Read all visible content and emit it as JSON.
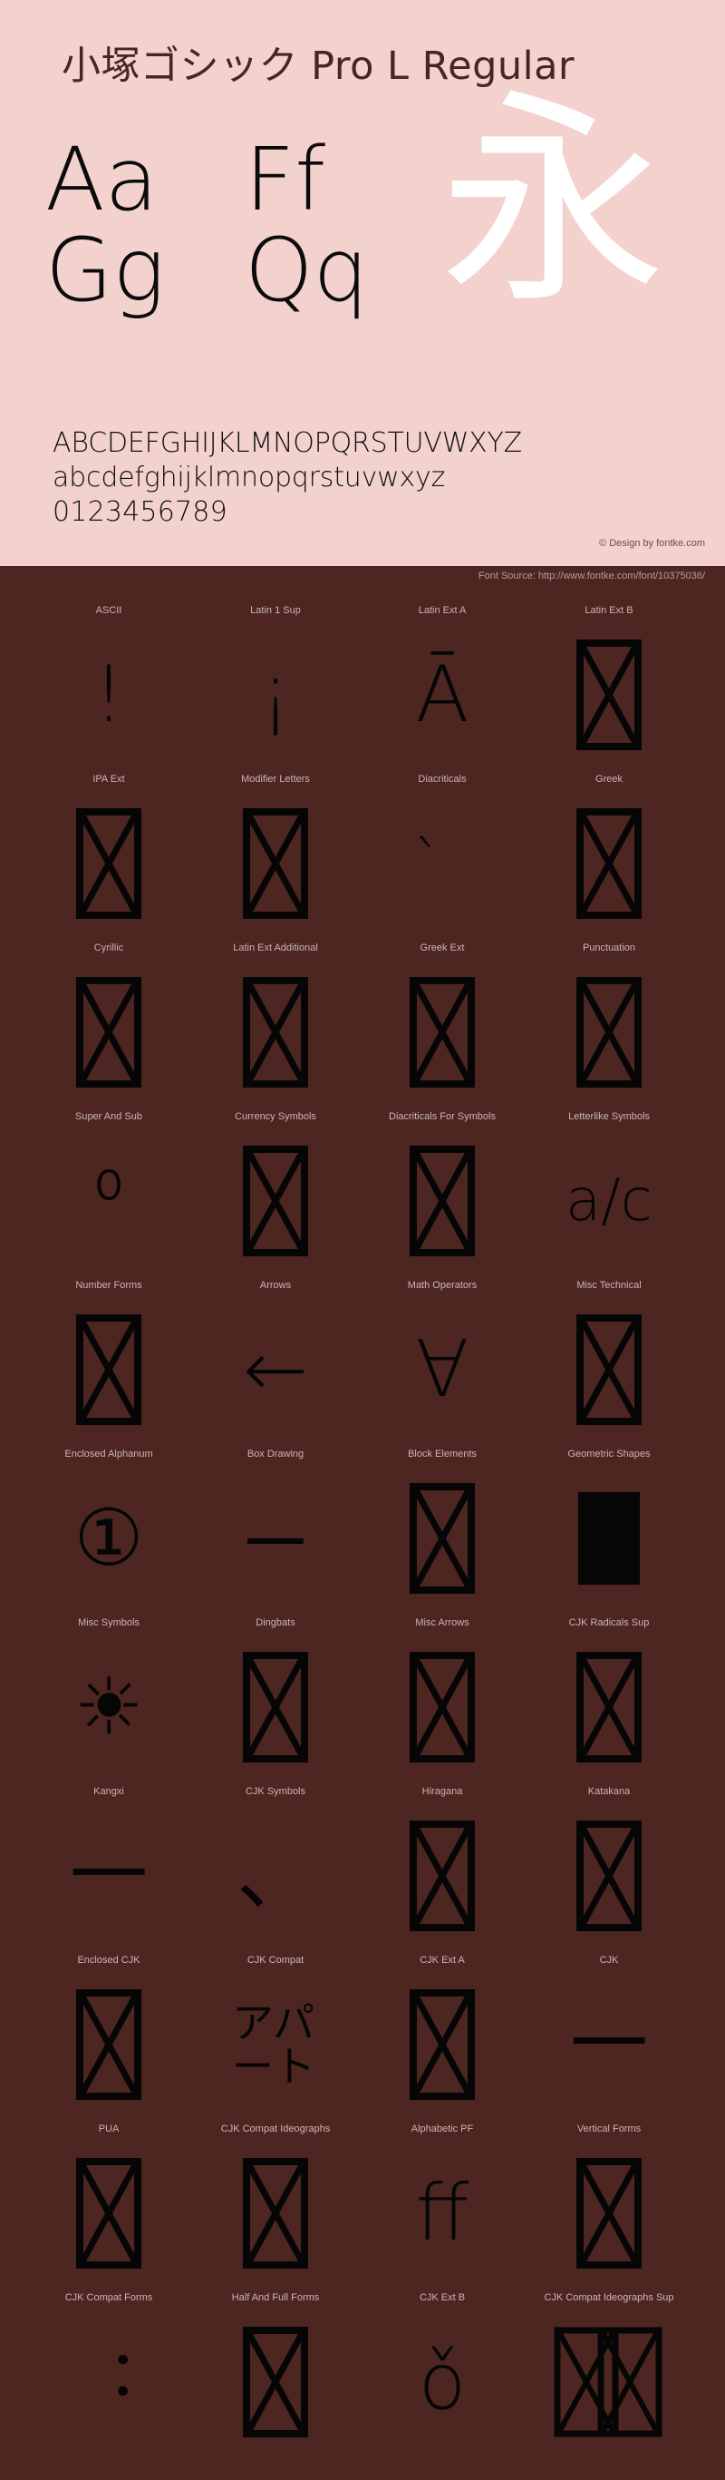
{
  "specimen": {
    "title": "小塚ゴシック Pro L Regular",
    "sample_glyphs": [
      [
        "Aa",
        "Ff"
      ],
      [
        "Gg",
        "Qq"
      ]
    ],
    "watermark_glyph": "永",
    "uppercase": "ABCDEFGHIJKLMNOPQRSTUVWXYZ",
    "lowercase": "abcdefghijklmnopqrstuvwxyz",
    "digits": "0123456789",
    "credit": "© Design by fontke.com",
    "colors": {
      "panel_background": "#f3d1cd",
      "page_background": "#4d2622",
      "glyph": "#0b0b0b",
      "watermark": "#ffffff",
      "label": "#cbb5b2"
    }
  },
  "source_bar": {
    "text": "Font Source: http://www.fontke.com/font/10375036/"
  },
  "blocks": [
    {
      "label": "ASCII",
      "sample": "!",
      "kind": "glyph"
    },
    {
      "label": "Latin 1 Sup",
      "sample": "¡",
      "kind": "glyph"
    },
    {
      "label": "Latin Ext A",
      "sample": "Ā",
      "kind": "glyph"
    },
    {
      "label": "Latin Ext B",
      "sample": "",
      "kind": "tofu"
    },
    {
      "label": "IPA Ext",
      "sample": "",
      "kind": "tofu"
    },
    {
      "label": "Modifier Letters",
      "sample": "",
      "kind": "tofu"
    },
    {
      "label": "Diacriticals",
      "sample": "̀",
      "kind": "glyph-small"
    },
    {
      "label": "Greek",
      "sample": "",
      "kind": "tofu"
    },
    {
      "label": "Cyrillic",
      "sample": "",
      "kind": "tofu"
    },
    {
      "label": "Latin Ext Additional",
      "sample": "",
      "kind": "tofu"
    },
    {
      "label": "Greek Ext",
      "sample": "",
      "kind": "tofu"
    },
    {
      "label": "Punctuation",
      "sample": "",
      "kind": "tofu"
    },
    {
      "label": "Super And Sub",
      "sample": "⁰",
      "kind": "glyph"
    },
    {
      "label": "Currency Symbols",
      "sample": "",
      "kind": "tofu"
    },
    {
      "label": "Diacriticals For Symbols",
      "sample": "",
      "kind": "tofu"
    },
    {
      "label": "Letterlike Symbols",
      "sample": "a/c",
      "kind": "glyph-small"
    },
    {
      "label": "Number Forms",
      "sample": "",
      "kind": "tofu"
    },
    {
      "label": "Arrows",
      "sample": "←",
      "kind": "glyph"
    },
    {
      "label": "Math Operators",
      "sample": "∀",
      "kind": "glyph"
    },
    {
      "label": "Misc Technical",
      "sample": "",
      "kind": "tofu"
    },
    {
      "label": "Enclosed Alphanum",
      "sample": "①",
      "kind": "glyph"
    },
    {
      "label": "Box Drawing",
      "sample": "─",
      "kind": "glyph"
    },
    {
      "label": "Block Elements",
      "sample": "",
      "kind": "tofu"
    },
    {
      "label": "Geometric Shapes",
      "sample": "",
      "kind": "rect"
    },
    {
      "label": "Misc Symbols",
      "sample": "☀",
      "kind": "glyph"
    },
    {
      "label": "Dingbats",
      "sample": "",
      "kind": "tofu"
    },
    {
      "label": "Misc Arrows",
      "sample": "",
      "kind": "tofu"
    },
    {
      "label": "CJK Radicals Sup",
      "sample": "",
      "kind": "tofu"
    },
    {
      "label": "Kangxi",
      "sample": "⼀",
      "kind": "glyph"
    },
    {
      "label": "CJK Symbols",
      "sample": "、",
      "kind": "glyph"
    },
    {
      "label": "Hiragana",
      "sample": "",
      "kind": "tofu"
    },
    {
      "label": "Katakana",
      "sample": "",
      "kind": "tofu"
    },
    {
      "label": "Enclosed CJK",
      "sample": "",
      "kind": "tofu"
    },
    {
      "label": "CJK Compat",
      "sample": "アパート",
      "kind": "glyph-cjk"
    },
    {
      "label": "CJK Ext A",
      "sample": "",
      "kind": "tofu"
    },
    {
      "label": "CJK",
      "sample": "一",
      "kind": "glyph"
    },
    {
      "label": "PUA",
      "sample": "",
      "kind": "tofu"
    },
    {
      "label": "CJK Compat Ideographs",
      "sample": "",
      "kind": "tofu"
    },
    {
      "label": "Alphabetic PF",
      "sample": "ff",
      "kind": "glyph"
    },
    {
      "label": "Vertical Forms",
      "sample": "",
      "kind": "tofu"
    },
    {
      "label": "CJK Compat Forms",
      "sample": "︓",
      "kind": "glyph-dots"
    },
    {
      "label": "Half And Full Forms",
      "sample": "",
      "kind": "tofu"
    },
    {
      "label": "CJK Ext B",
      "sample": "ǒ",
      "kind": "glyph"
    },
    {
      "label": "CJK Compat Ideographs Sup",
      "sample": "",
      "kind": "tofu-overlap"
    }
  ]
}
